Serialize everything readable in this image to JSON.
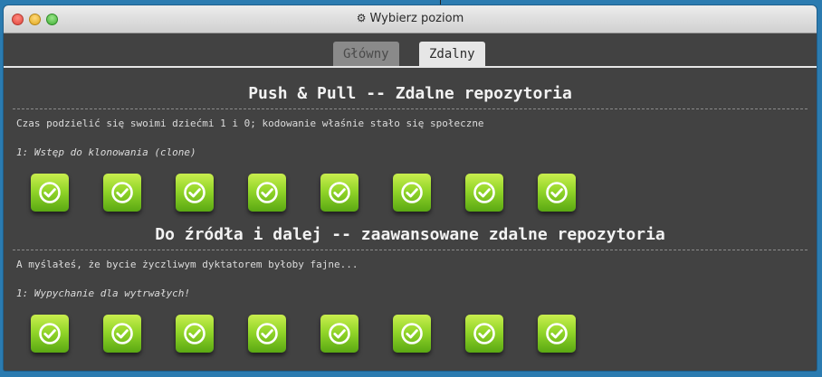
{
  "window": {
    "title": "Wybierz poziom",
    "title_icon": "gear-icon"
  },
  "tabs": [
    {
      "label": "Główny",
      "active": false
    },
    {
      "label": "Zdalny",
      "active": true
    }
  ],
  "sections": [
    {
      "title": "Push & Pull -- Zdalne repozytoria",
      "description": "Czas podzielić się swoimi dziećmi 1 i 0; kodowanie właśnie stało się społeczne",
      "subtitle": "1: Wstęp do klonowania (clone)",
      "levels": [
        {
          "status": "completed"
        },
        {
          "status": "completed"
        },
        {
          "status": "completed"
        },
        {
          "status": "completed"
        },
        {
          "status": "completed"
        },
        {
          "status": "completed"
        },
        {
          "status": "completed"
        },
        {
          "status": "completed"
        }
      ]
    },
    {
      "title": "Do źródła i dalej -- zaawansowane zdalne repozytoria",
      "description": "A myślałeś, że bycie życzliwym dyktatorem byłoby fajne...",
      "subtitle": "1: Wypychanie dla wytrwałych!",
      "levels": [
        {
          "status": "completed"
        },
        {
          "status": "completed"
        },
        {
          "status": "completed"
        },
        {
          "status": "completed"
        },
        {
          "status": "completed"
        },
        {
          "status": "completed"
        },
        {
          "status": "completed"
        },
        {
          "status": "completed"
        }
      ]
    }
  ],
  "colors": {
    "level_complete": "#7cc623",
    "background": "#424242",
    "desktop": "#2b7bb0"
  }
}
